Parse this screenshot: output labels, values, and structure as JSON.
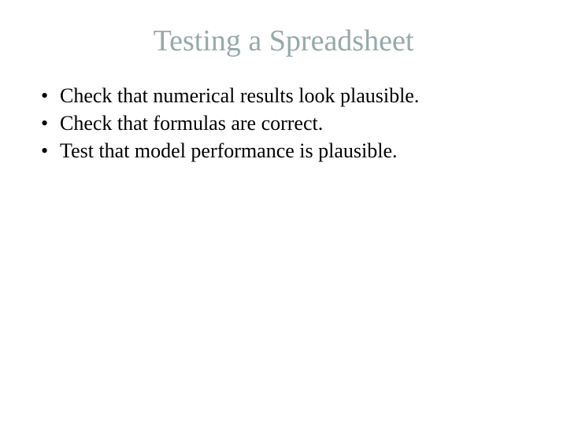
{
  "title": "Testing a Spreadsheet",
  "bullets": [
    "Check that numerical results look plausible.",
    "Check that formulas are correct.",
    "Test that model performance is plausible."
  ]
}
